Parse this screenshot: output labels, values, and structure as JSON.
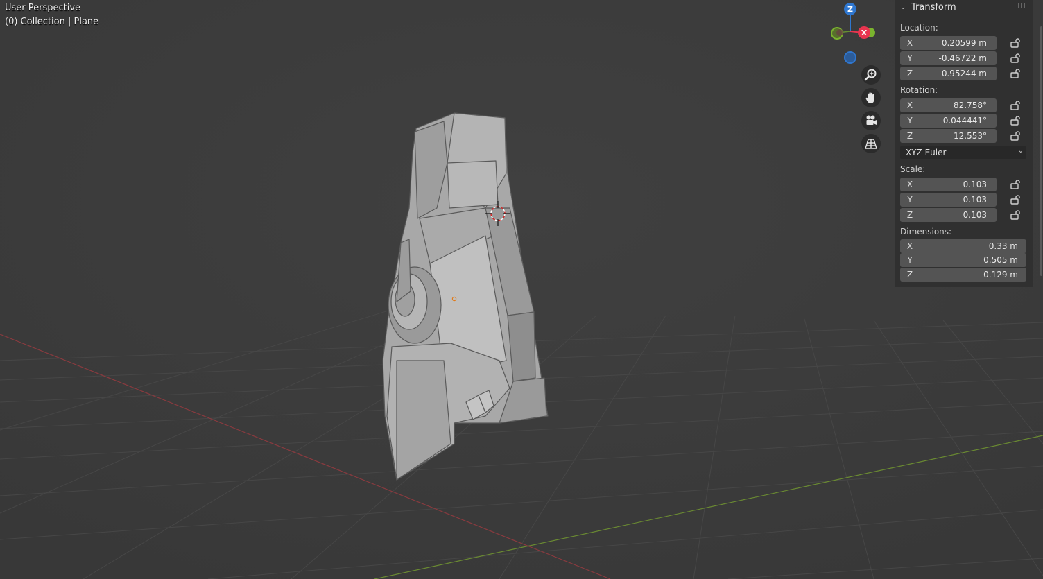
{
  "viewport": {
    "view_name": "User Perspective",
    "collection_label": "(0) Collection | Plane"
  },
  "gizmo": {
    "z_label": "Z",
    "x_label": "X",
    "colors": {
      "x": "#e8344f",
      "y": "#7ab32e",
      "z": "#2f77d0"
    }
  },
  "nav_icons": [
    "zoom-icon",
    "hand-pan-icon",
    "camera-icon",
    "grid-perspective-icon"
  ],
  "transform": {
    "title": "Transform",
    "location_label": "Location:",
    "location": [
      {
        "axis": "X",
        "value": "0.20599 m"
      },
      {
        "axis": "Y",
        "value": "-0.46722 m"
      },
      {
        "axis": "Z",
        "value": "0.95244 m"
      }
    ],
    "rotation_label": "Rotation:",
    "rotation": [
      {
        "axis": "X",
        "value": "82.758°"
      },
      {
        "axis": "Y",
        "value": "-0.044441°"
      },
      {
        "axis": "Z",
        "value": "12.553°"
      }
    ],
    "rotation_mode": "XYZ Euler",
    "scale_label": "Scale:",
    "scale": [
      {
        "axis": "X",
        "value": "0.103"
      },
      {
        "axis": "Y",
        "value": "0.103"
      },
      {
        "axis": "Z",
        "value": "0.103"
      }
    ],
    "dimensions_label": "Dimensions:",
    "dimensions": [
      {
        "axis": "X",
        "value": "0.33 m"
      },
      {
        "axis": "Y",
        "value": "0.505 m"
      },
      {
        "axis": "Z",
        "value": "0.129 m"
      }
    ]
  }
}
